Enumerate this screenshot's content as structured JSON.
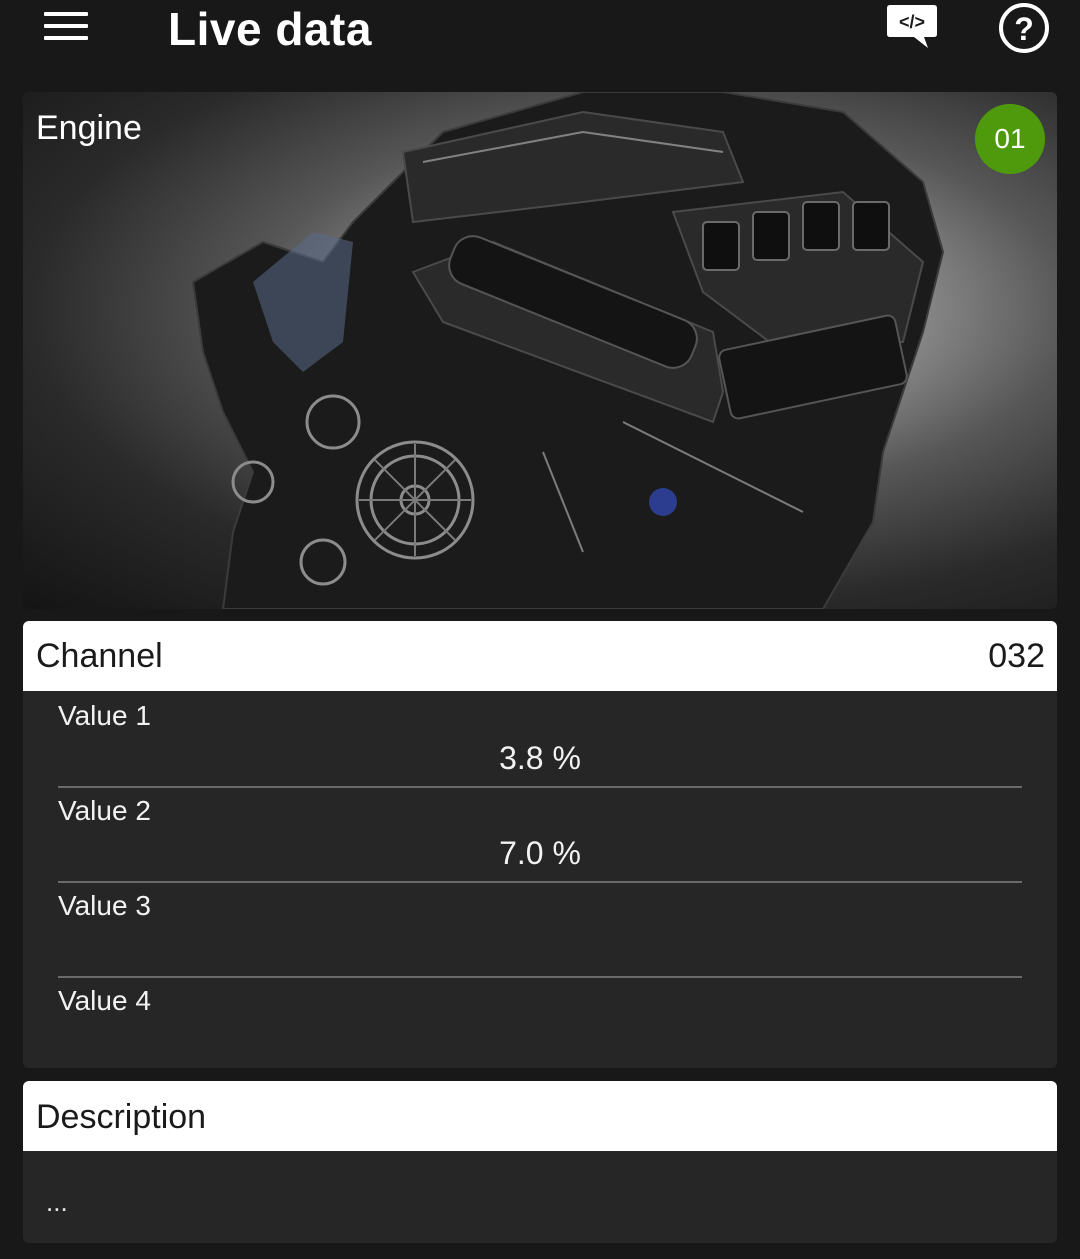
{
  "header": {
    "title": "Live data",
    "menu_icon": "hamburger-menu-icon",
    "code_icon": "code-chat-icon",
    "code_icon_text": "</>",
    "help_icon": "help-circle-icon",
    "help_icon_text": "?"
  },
  "engine_card": {
    "label": "Engine",
    "badge": "01",
    "badge_color": "#4f9a0c",
    "image": "engine-photo"
  },
  "channel": {
    "label": "Channel",
    "number": "032",
    "values": [
      {
        "label": "Value 1",
        "reading": "3.8 %"
      },
      {
        "label": "Value 2",
        "reading": "7.0 %"
      },
      {
        "label": "Value 3",
        "reading": ""
      },
      {
        "label": "Value 4",
        "reading": ""
      }
    ]
  },
  "description": {
    "label": "Description",
    "text": "..."
  }
}
